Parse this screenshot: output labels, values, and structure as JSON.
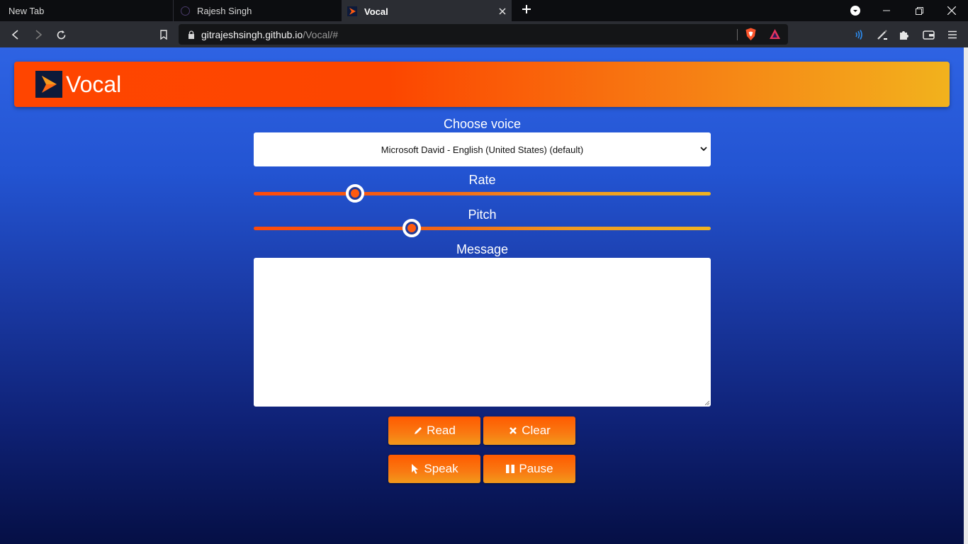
{
  "browser": {
    "tabs": [
      {
        "label": "New Tab",
        "active": false
      },
      {
        "label": "Rajesh Singh",
        "active": false
      },
      {
        "label": "Vocal",
        "active": true
      }
    ],
    "url": {
      "host": "gitrajeshsingh.github.io",
      "path": "/Vocal/#"
    }
  },
  "app": {
    "title": "Vocal",
    "brand_color": "#ff4500",
    "accent_color": "#f2b21d"
  },
  "form": {
    "voice_label": "Choose voice",
    "voice_selected": "Microsoft David - English (United States) (default)",
    "rate_label": "Rate",
    "rate_level": 0.21,
    "pitch_label": "Pitch",
    "pitch_level": 0.34,
    "message_label": "Message",
    "message_value": ""
  },
  "buttons": {
    "read": "Read",
    "clear": "Clear",
    "speak": "Speak",
    "pause": "Pause"
  }
}
